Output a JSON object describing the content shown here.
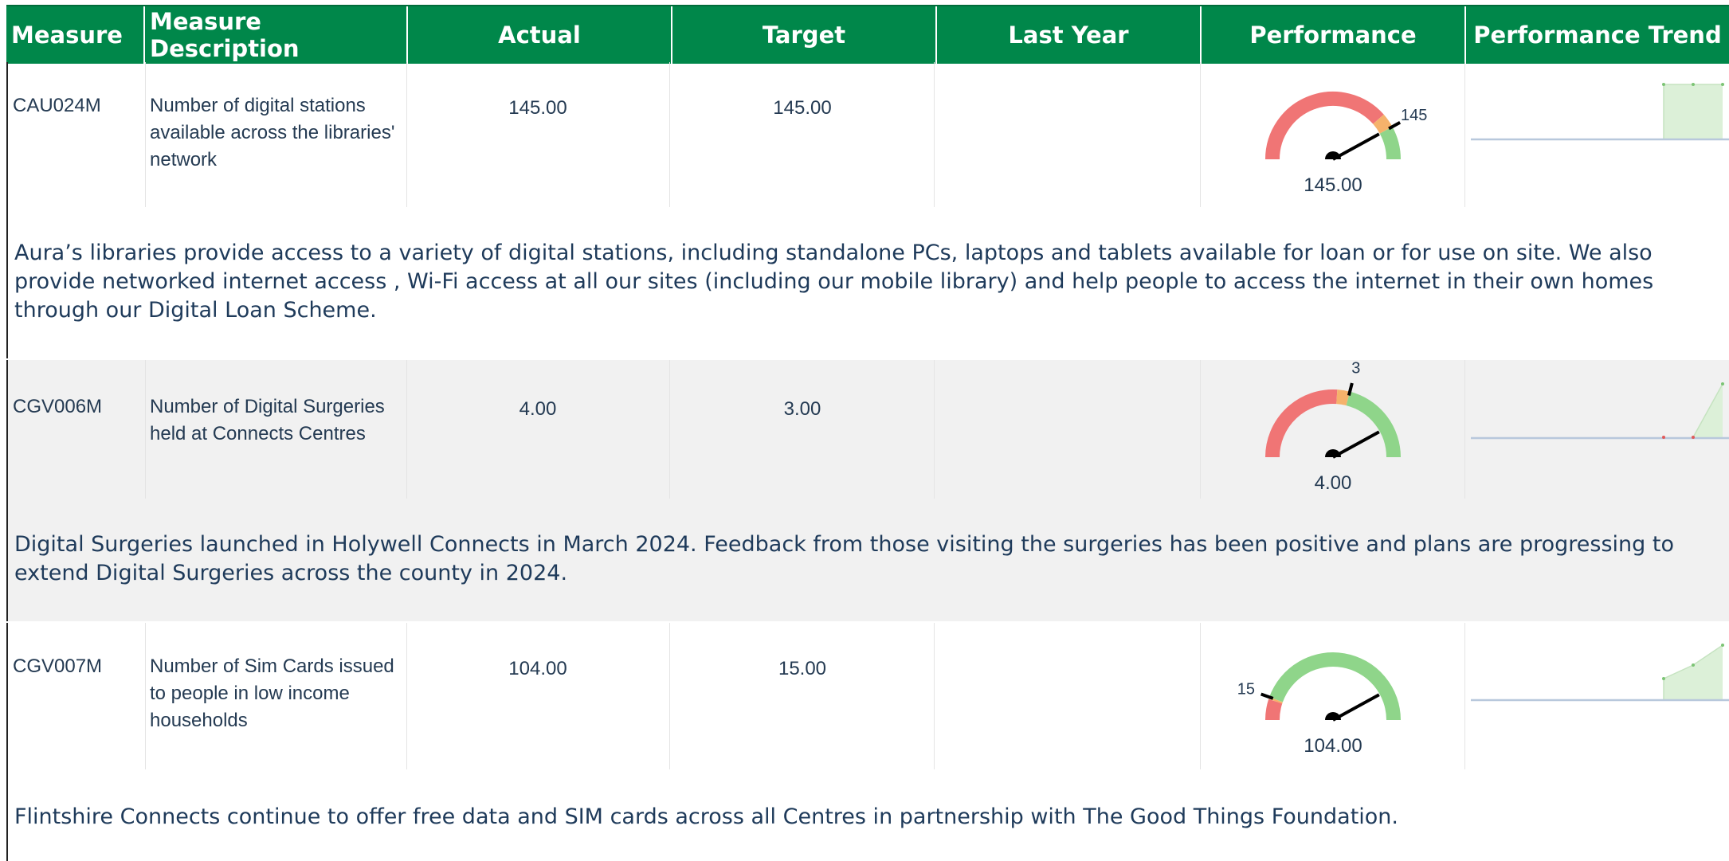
{
  "columns": {
    "measure": "Measure",
    "description": "Measure Description",
    "actual": "Actual",
    "target": "Target",
    "last_year": "Last Year",
    "performance": "Performance",
    "trend": "Performance Trend"
  },
  "colors": {
    "header_bg": "#00874a",
    "gauge_red": "#f07575",
    "gauge_amber": "#f5b26b",
    "gauge_green": "#8fd58a",
    "trend_fill": "#dcf0d8",
    "trend_line": "#b8c8dc"
  },
  "rows": [
    {
      "code": "CAU024M",
      "description": "Number of digital stations available across the libraries' network",
      "actual": "145.00",
      "target": "145.00",
      "last_year": "",
      "gauge": {
        "value_label": "145.00",
        "target_label": "145",
        "value_fraction": 0.84,
        "target_fraction": 0.84,
        "red_end": 0.77,
        "amber_end": 0.84
      },
      "comment": "Aura’s libraries provide access to a variety of digital stations, including standalone PCs, laptops and tablets available for loan or for use on site. We also provide networked internet access , Wi-Fi access at all our sites (including our mobile library) and help people to access the internet in their own homes through our Digital Loan Scheme."
    },
    {
      "code": "CGV006M",
      "description": "Number of Digital Surgeries held at Connects Centres",
      "actual": "4.00",
      "target": "3.00",
      "last_year": "",
      "gauge": {
        "value_label": "4.00",
        "target_label": "3",
        "value_fraction": 0.84,
        "target_fraction": 0.58,
        "red_end": 0.52,
        "amber_end": 0.58
      },
      "comment": "Digital Surgeries launched in Holywell Connects in March 2024. Feedback from those visiting the surgeries has been positive and plans are progressing to extend Digital Surgeries across the county in 2024."
    },
    {
      "code": "CGV007M",
      "description": "Number of Sim Cards issued to people in low income households",
      "actual": "104.00",
      "target": "15.00",
      "last_year": "",
      "gauge": {
        "value_label": "104.00",
        "target_label": "15",
        "value_fraction": 0.84,
        "target_fraction": 0.11,
        "red_end": 0.1,
        "amber_end": 0.11
      },
      "comment": "Flintshire Connects continue to offer free data and SIM cards across all Centres in partnership with The Good Things Foundation."
    }
  ]
}
